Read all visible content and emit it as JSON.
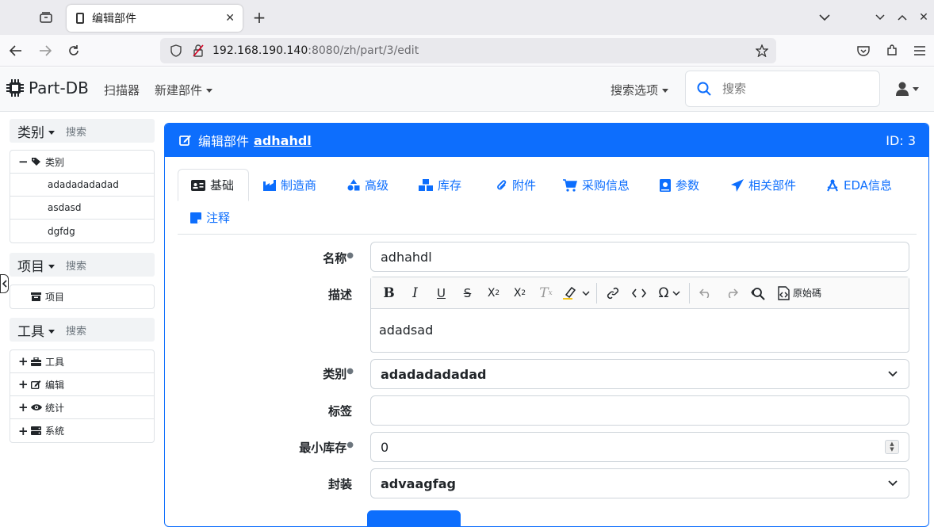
{
  "browser": {
    "tab_title": "编辑部件",
    "url_host": "192.168.190.140",
    "url_rest": ":8080/zh/part/3/edit"
  },
  "app": {
    "brand": "Part-DB",
    "nav": {
      "scanner": "扫描器",
      "new_part": "新建部件"
    },
    "search_options": "搜索选项",
    "search_placeholder": "搜索"
  },
  "sidebar": {
    "sections": [
      {
        "title": "类别",
        "search": "搜索",
        "root": "类别",
        "items": [
          "adadadadadad",
          "asdasd",
          "dgfdg"
        ]
      },
      {
        "title": "项目",
        "search": "搜索",
        "items": [
          "项目"
        ]
      },
      {
        "title": "工具",
        "search": "搜索",
        "items": [
          "工具",
          "编辑",
          "统计",
          "系统"
        ]
      }
    ]
  },
  "card": {
    "header_prefix": "编辑部件",
    "part_name": "adhahdl",
    "id_label": "ID: 3"
  },
  "tabs": [
    {
      "label": "基础",
      "icon": "id-card-icon",
      "active": true
    },
    {
      "label": "制造商",
      "icon": "industry-icon"
    },
    {
      "label": "高级",
      "icon": "shapes-icon"
    },
    {
      "label": "库存",
      "icon": "boxes-icon"
    },
    {
      "label": "附件",
      "icon": "paperclip-icon"
    },
    {
      "label": "采购信息",
      "icon": "cart-icon"
    },
    {
      "label": "参数",
      "icon": "book-icon"
    },
    {
      "label": "相关部件",
      "icon": "paper-plane-icon"
    },
    {
      "label": "EDA信息",
      "icon": "compass-drafting-icon"
    },
    {
      "label": "注释",
      "icon": "sticky-note-icon"
    }
  ],
  "form": {
    "name_label": "名称",
    "name_value": "adhahdl",
    "description_label": "描述",
    "description_value": "adadsad",
    "source_label": "原始碼",
    "category_label": "类别",
    "category_value": "adadadadadad",
    "tags_label": "标签",
    "tags_value": "",
    "min_stock_label": "最小库存",
    "min_stock_value": "0",
    "footprint_label": "封装",
    "footprint_value": "advaagfag"
  },
  "colors": {
    "primary": "#0d6efd"
  }
}
